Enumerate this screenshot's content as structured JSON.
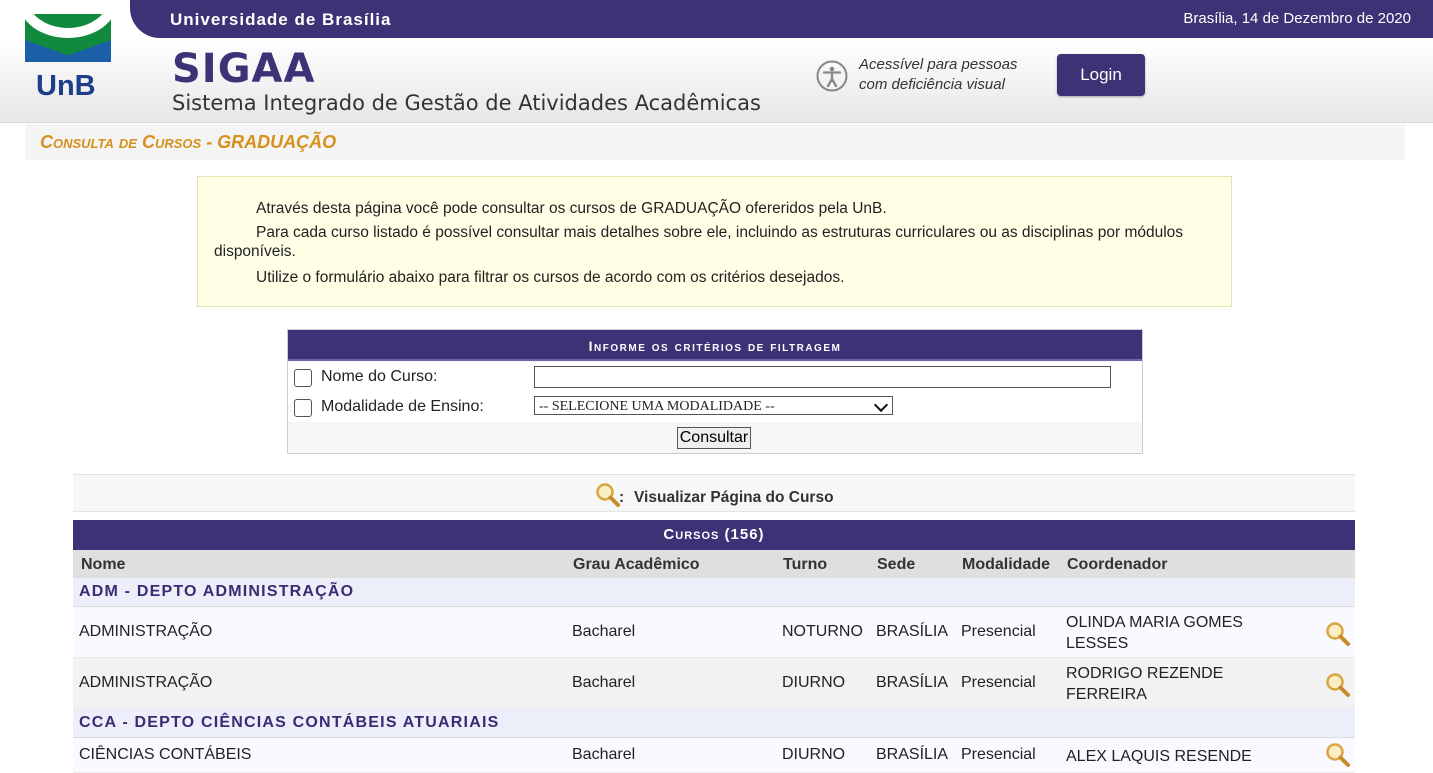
{
  "topbar": {
    "university": "Universidade de Brasília",
    "date": "Brasília, 14 de Dezembro de 2020"
  },
  "header": {
    "logo_text": "UnB",
    "system_name": "SIGAA",
    "system_full": "Sistema Integrado de Gestão de Atividades Acadêmicas",
    "accessibility_line1": "Acessível para pessoas",
    "accessibility_line2": "com deficiência visual",
    "login_label": "Login",
    "accent": "#3c3275"
  },
  "page_title": "Consulta de Cursos - GRADUAÇÃO",
  "info": {
    "p1": "Através desta página você pode consultar os cursos de GRADUAÇÃO ofereridos pela UnB.",
    "p2": "Para cada curso listado é possível consultar mais detalhes sobre ele, incluindo as estruturas curriculares ou as disciplinas por módulos disponíveis.",
    "p3": "Utilize o formulário abaixo para filtrar os cursos de acordo com os critérios desejados."
  },
  "filter": {
    "caption": "Informe os critérios de filtragem",
    "course_name_label": "Nome do Curso:",
    "course_name_value": "",
    "modality_label": "Modalidade de Ensino:",
    "modality_selected": "-- SELECIONE UMA MODALIDADE --",
    "submit_label": "Consultar"
  },
  "legend": {
    "colon": ":",
    "label": "Visualizar Página do Curso"
  },
  "courses": {
    "caption": "Cursos (156)",
    "columns": [
      "Nome",
      "Grau Acadêmico",
      "Turno",
      "Sede",
      "Modalidade",
      "Coordenador"
    ],
    "groups": [
      {
        "name": "ADM - DEPTO ADMINISTRAÇÃO",
        "rows": [
          {
            "nome": "ADMINISTRAÇÃO",
            "grau": "Bacharel",
            "turno": "NOTURNO",
            "sede": "BRASÍLIA",
            "modalidade": "Presencial",
            "coordenador": "OLINDA MARIA GOMES LESSES"
          },
          {
            "nome": "ADMINISTRAÇÃO",
            "grau": "Bacharel",
            "turno": "DIURNO",
            "sede": "BRASÍLIA",
            "modalidade": "Presencial",
            "coordenador": "RODRIGO REZENDE FERREIRA"
          }
        ]
      },
      {
        "name": "CCA - DEPTO CIÊNCIAS CONTÁBEIS ATUARIAIS",
        "rows": [
          {
            "nome": "CIÊNCIAS CONTÁBEIS",
            "grau": "Bacharel",
            "turno": "DIURNO",
            "sede": "BRASÍLIA",
            "modalidade": "Presencial",
            "coordenador": "ALEX LAQUIS RESENDE"
          }
        ]
      }
    ]
  }
}
